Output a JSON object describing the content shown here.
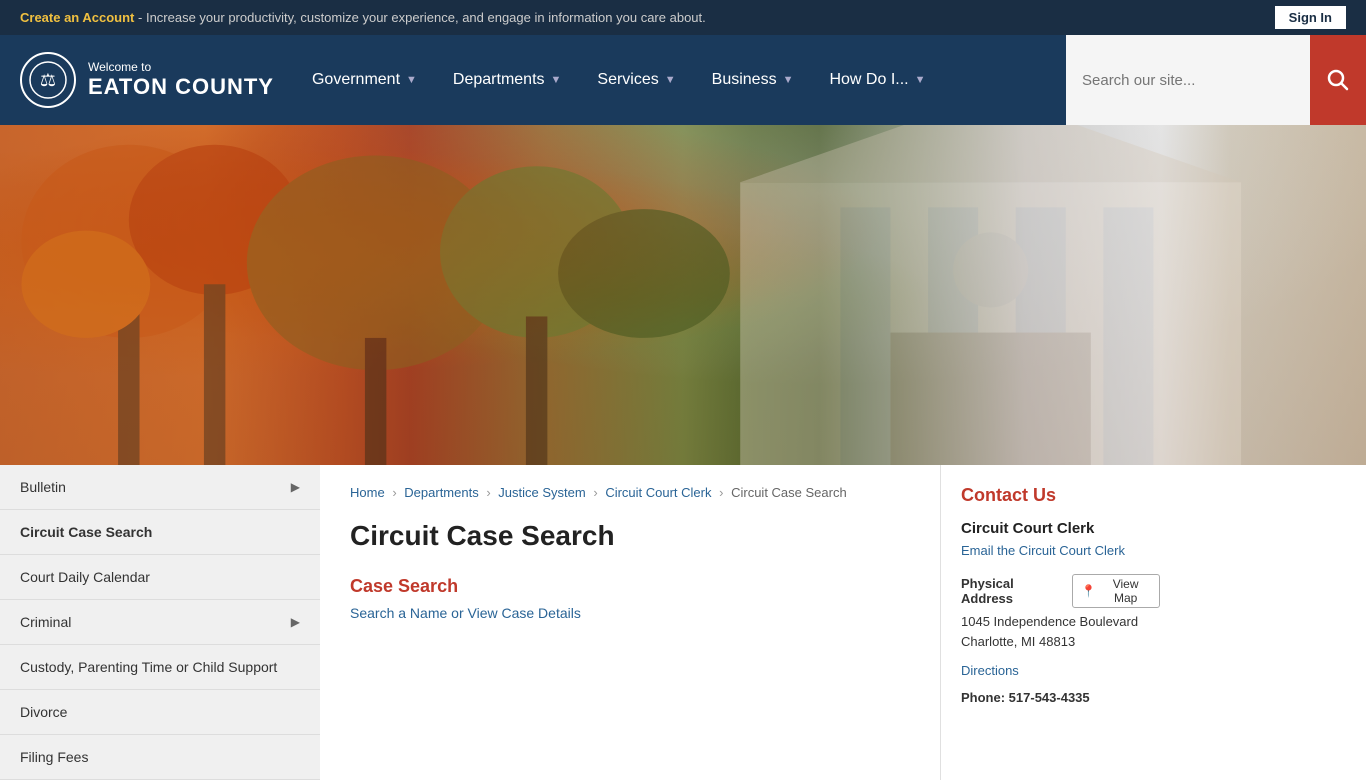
{
  "topbar": {
    "create_account_text": "Create an Account",
    "tagline": " - Increase your productivity, customize your experience, and engage in information you care about.",
    "sign_in_label": "Sign In"
  },
  "header": {
    "welcome": "Welcome to",
    "county_name": "EATON COUNTY",
    "nav": [
      {
        "label": "Government",
        "id": "government"
      },
      {
        "label": "Departments",
        "id": "departments"
      },
      {
        "label": "Services",
        "id": "services"
      },
      {
        "label": "Business",
        "id": "business"
      },
      {
        "label": "How Do I...",
        "id": "how-do-i"
      }
    ],
    "search_placeholder": "Search our site..."
  },
  "breadcrumb": {
    "items": [
      {
        "label": "Home",
        "href": "#"
      },
      {
        "label": "Departments",
        "href": "#"
      },
      {
        "label": "Justice System",
        "href": "#"
      },
      {
        "label": "Circuit Court Clerk",
        "href": "#"
      },
      {
        "label": "Circuit Case Search",
        "href": "#"
      }
    ]
  },
  "sidebar": {
    "items": [
      {
        "label": "Bulletin",
        "has_arrow": true
      },
      {
        "label": "Circuit Case Search",
        "has_arrow": false,
        "active": true
      },
      {
        "label": "Court Daily Calendar",
        "has_arrow": false
      },
      {
        "label": "Criminal",
        "has_arrow": true
      },
      {
        "label": "Custody, Parenting Time or Child Support",
        "has_arrow": false
      },
      {
        "label": "Divorce",
        "has_arrow": false
      },
      {
        "label": "Filing Fees",
        "has_arrow": false
      }
    ]
  },
  "main": {
    "page_title": "Circuit Case Search",
    "case_search_title": "Case Search",
    "case_search_link_text": "Search a Name or View Case Details",
    "case_search_link_href": "#"
  },
  "contact": {
    "section_title": "Contact Us",
    "org_name": "Circuit Court Clerk",
    "email_label": "Email the Circuit Court Clerk",
    "email_href": "#",
    "address_label": "Physical Address",
    "view_map_label": "View Map",
    "street": "1045 Independence Boulevard",
    "city_state_zip": "Charlotte, MI 48813",
    "directions_label": "Directions",
    "phone_prefix": "Phone: ",
    "phone_number": "517-543-4335"
  }
}
